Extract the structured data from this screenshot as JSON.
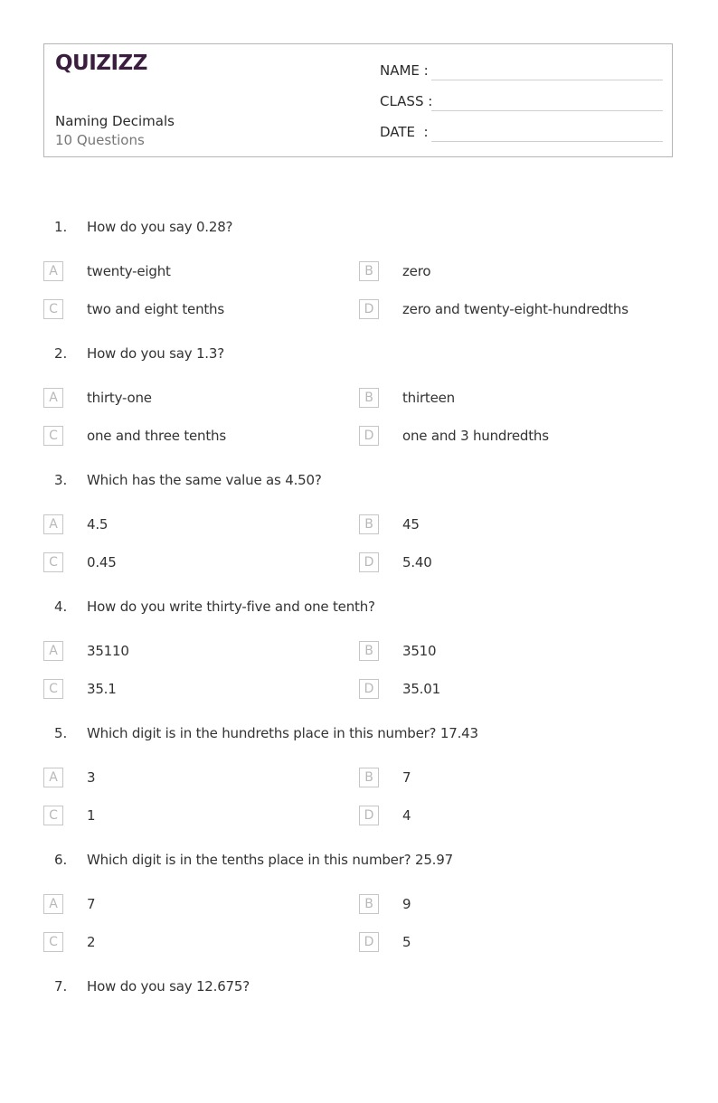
{
  "header": {
    "logo": "QUIZIZZ",
    "title": "Naming Decimals",
    "question_count": "10 Questions",
    "fields": [
      {
        "label": "NAME :"
      },
      {
        "label": "CLASS :"
      },
      {
        "label": "DATE  :"
      }
    ]
  },
  "questions": [
    {
      "number": "1.",
      "text": "How do you say 0.28?",
      "options": [
        {
          "letter": "A",
          "text": "twenty-eight"
        },
        {
          "letter": "B",
          "text": "zero"
        },
        {
          "letter": "C",
          "text": "two and eight tenths"
        },
        {
          "letter": "D",
          "text": "zero and twenty-eight-hundredths"
        }
      ]
    },
    {
      "number": "2.",
      "text": "How do you say 1.3?",
      "options": [
        {
          "letter": "A",
          "text": "thirty-one"
        },
        {
          "letter": "B",
          "text": "thirteen"
        },
        {
          "letter": "C",
          "text": "one and three tenths"
        },
        {
          "letter": "D",
          "text": "one and 3 hundredths"
        }
      ]
    },
    {
      "number": "3.",
      "text": "Which has the same value as 4.50?",
      "options": [
        {
          "letter": "A",
          "text": "4.5"
        },
        {
          "letter": "B",
          "text": "45"
        },
        {
          "letter": "C",
          "text": "0.45"
        },
        {
          "letter": "D",
          "text": "5.40"
        }
      ]
    },
    {
      "number": "4.",
      "text": "How do you write thirty-five and one tenth?",
      "options": [
        {
          "letter": "A",
          "text": "35110"
        },
        {
          "letter": "B",
          "text": "3510"
        },
        {
          "letter": "C",
          "text": "35.1"
        },
        {
          "letter": "D",
          "text": "35.01"
        }
      ]
    },
    {
      "number": "5.",
      "text": "Which digit is in the hundreths place in this number? 17.43",
      "options": [
        {
          "letter": "A",
          "text": "3"
        },
        {
          "letter": "B",
          "text": "7"
        },
        {
          "letter": "C",
          "text": "1"
        },
        {
          "letter": "D",
          "text": "4"
        }
      ]
    },
    {
      "number": "6.",
      "text": "Which digit is in the tenths place in this number? 25.97",
      "options": [
        {
          "letter": "A",
          "text": "7"
        },
        {
          "letter": "B",
          "text": "9"
        },
        {
          "letter": "C",
          "text": "2"
        },
        {
          "letter": "D",
          "text": "5"
        }
      ]
    },
    {
      "number": "7.",
      "text": "How do you say 12.675?",
      "options": []
    }
  ]
}
